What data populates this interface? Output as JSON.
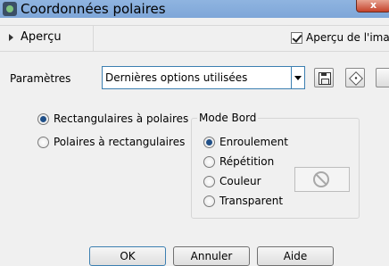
{
  "window": {
    "title": "Coordonnées polaires",
    "close_glyph": "x"
  },
  "preview": {
    "toggle_label": "Aperçu",
    "checkbox_label": "Aperçu de l'imag",
    "checkbox_checked": true
  },
  "settings": {
    "label": "Paramètres",
    "preset_value": "Dernières options utilisées"
  },
  "conversion": {
    "options": [
      "Rectangulaires à polaires",
      "Polaires à rectangulaires"
    ],
    "selected": 0
  },
  "edge_mode": {
    "title": "Mode Bord",
    "options": [
      "Enroulement",
      "Répétition",
      "Couleur",
      "Transparent"
    ],
    "selected": 0
  },
  "buttons": {
    "ok": "OK",
    "cancel": "Annuler",
    "help": "Aide"
  }
}
